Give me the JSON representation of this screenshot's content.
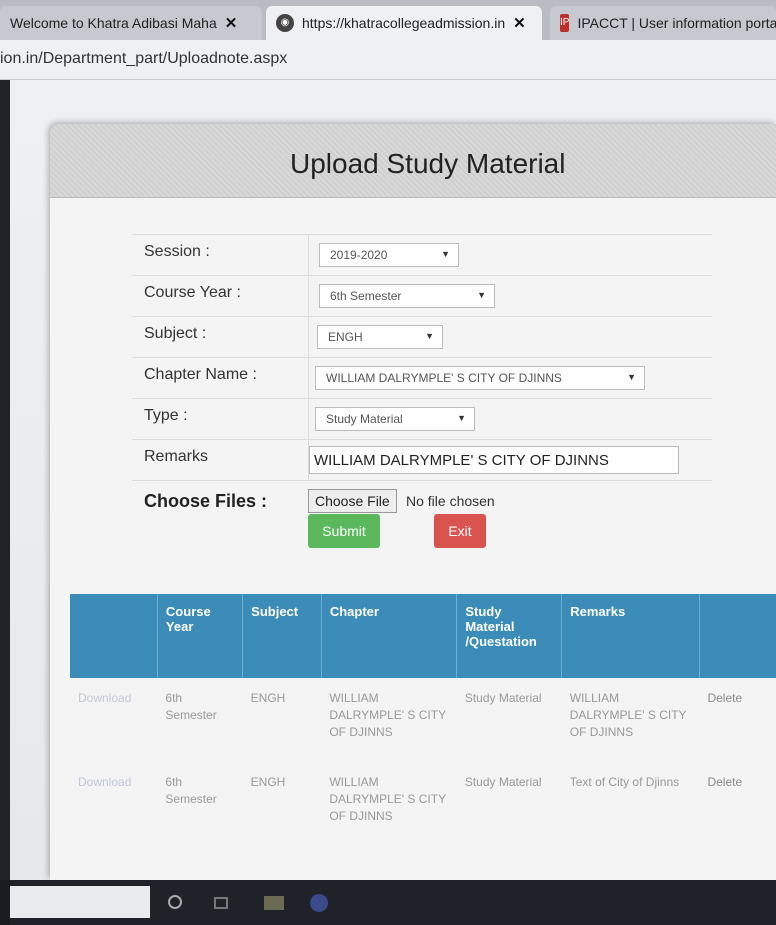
{
  "browser": {
    "tabs": [
      {
        "label": "Welcome to Khatra Adibasi Maha"
      },
      {
        "label": "https://khatracollegeadmission.in"
      },
      {
        "label": "IPACCT | User information porta"
      }
    ],
    "address": "ion.in/Department_part/Uploadnote.aspx"
  },
  "page": {
    "title": "Upload Study Material"
  },
  "form": {
    "session_label": "Session :",
    "session_value": "2019-2020",
    "course_year_label": "Course Year :",
    "course_year_value": "6th Semester",
    "subject_label": "Subject :",
    "subject_value": "ENGH",
    "chapter_label": "Chapter Name :",
    "chapter_value": "WILLIAM DALRYMPLE' S CITY OF DJINNS",
    "type_label": "Type :",
    "type_value": "Study Material",
    "remarks_label": "Remarks",
    "remarks_value": "WILLIAM DALRYMPLE' S CITY OF DJINNS",
    "files_label": "Choose Files :",
    "file_button": "Choose File",
    "file_status": "No file chosen",
    "submit_label": "Submit",
    "exit_label": "Exit"
  },
  "table": {
    "headers": [
      "",
      "Course Year",
      "Subject",
      "Chapter",
      "Study Material /Questation",
      "Remarks",
      ""
    ],
    "rows": [
      {
        "link": "Download",
        "course_year": "6th Semester",
        "subject": "ENGH",
        "chapter": "WILLIAM DALRYMPLE' S CITY OF DJINNS",
        "type": "Study Material",
        "remarks": "WILLIAM DALRYMPLE' S CITY OF DJINNS",
        "action": "Delete"
      },
      {
        "link": "Download",
        "course_year": "6th Semester",
        "subject": "ENGH",
        "chapter": "WILLIAM DALRYMPLE' S CITY OF DJINNS",
        "type": "Study Material",
        "remarks": "Text of City of Djinns",
        "action": "Delete"
      }
    ]
  }
}
